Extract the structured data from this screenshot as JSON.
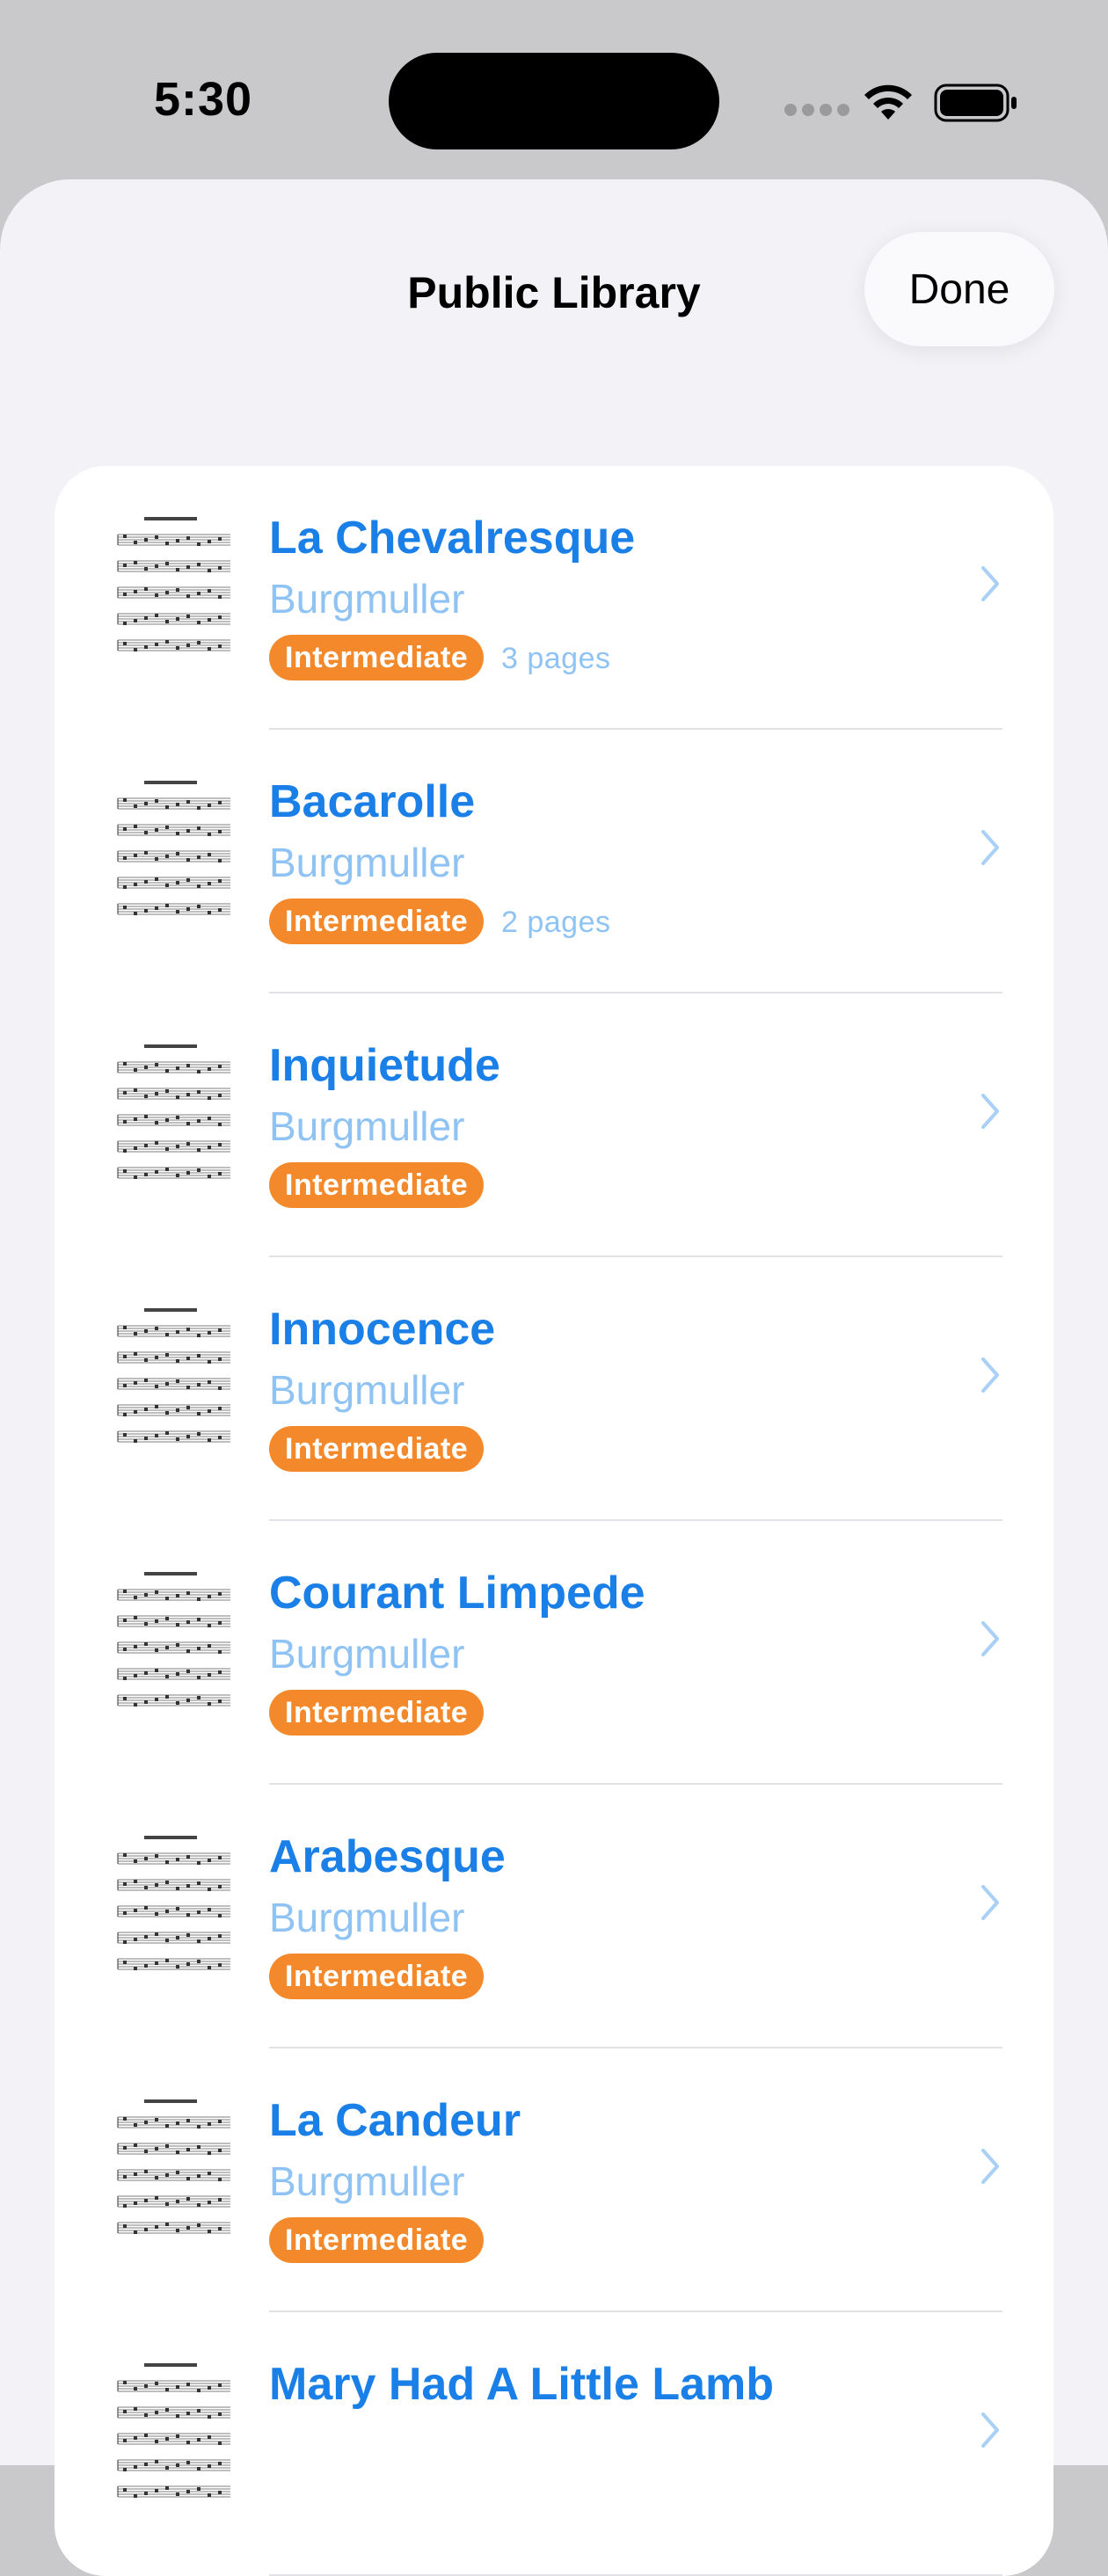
{
  "status_bar": {
    "time": "5:30"
  },
  "header": {
    "title": "Public Library",
    "done_label": "Done"
  },
  "colors": {
    "accent": "#1a7fe6",
    "accent_light": "#8fc3f3",
    "badge": "#f4892b"
  },
  "items": [
    {
      "title": "La Chevalresque",
      "composer": "Burgmuller",
      "level": "Intermediate",
      "pages": "3 pages"
    },
    {
      "title": "Bacarolle",
      "composer": "Burgmuller",
      "level": "Intermediate",
      "pages": "2 pages"
    },
    {
      "title": "Inquietude",
      "composer": "Burgmuller",
      "level": "Intermediate",
      "pages": ""
    },
    {
      "title": "Innocence",
      "composer": "Burgmuller",
      "level": "Intermediate",
      "pages": ""
    },
    {
      "title": "Courant Limpede",
      "composer": "Burgmuller",
      "level": "Intermediate",
      "pages": ""
    },
    {
      "title": "Arabesque",
      "composer": "Burgmuller",
      "level": "Intermediate",
      "pages": ""
    },
    {
      "title": "La Candeur",
      "composer": "Burgmuller",
      "level": "Intermediate",
      "pages": ""
    },
    {
      "title": "Mary Had A Little Lamb",
      "composer": "",
      "level": "",
      "pages": ""
    }
  ]
}
